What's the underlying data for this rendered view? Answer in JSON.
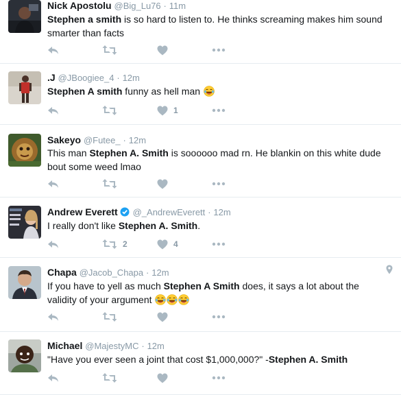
{
  "tweets": [
    {
      "name": "Nick Apostolu",
      "handle": "@Big_Lu76",
      "time": "11m",
      "line1": [
        {
          "t": "Stephen a smith",
          "b": true
        },
        {
          "t": " is so hard to listen to. He thinks screaming makes him sound"
        }
      ],
      "line2": [
        {
          "t": "smarter than facts"
        }
      ],
      "retweets": "",
      "likes": ""
    },
    {
      "name": ".J",
      "handle": "@JBoogiee_4",
      "time": "12m",
      "line1": [
        {
          "t": "Stephen A smith",
          "b": true
        },
        {
          "t": " funny as hell man"
        }
      ],
      "emoji_count": 1,
      "retweets": "",
      "likes": "1"
    },
    {
      "name": "Sakeyo",
      "handle": "@Futee_",
      "time": "12m",
      "line1": [
        {
          "t": "This man "
        },
        {
          "t": "Stephen A. Smith",
          "b": true
        },
        {
          "t": " is soooooo mad rn. He blankin on this white dude"
        }
      ],
      "line2": [
        {
          "t": "bout some weed lmao"
        }
      ],
      "retweets": "",
      "likes": ""
    },
    {
      "name": "Andrew Everett",
      "handle": "@_AndrewEverett",
      "time": "12m",
      "verified": true,
      "line1": [
        {
          "t": "I really don't like "
        },
        {
          "t": "Stephen A. Smith",
          "b": true
        },
        {
          "t": "."
        }
      ],
      "retweets": "2",
      "likes": "4"
    },
    {
      "name": "Chapa",
      "handle": "@Jacob_Chapa",
      "time": "12m",
      "has_location": true,
      "line1": [
        {
          "t": "If you have to yell as much "
        },
        {
          "t": "Stephen A Smith",
          "b": true
        },
        {
          "t": " does, it says a lot about the"
        }
      ],
      "line2": [
        {
          "t": "validity of your argument"
        }
      ],
      "emoji_count": 3,
      "retweets": "",
      "likes": ""
    },
    {
      "name": "Michael",
      "handle": "@MajestyMC",
      "time": "12m",
      "line1": [
        {
          "t": "\"Have you ever seen a joint that cost $1,000,000?\" -"
        },
        {
          "t": "Stephen A. Smith",
          "b": true
        }
      ],
      "retweets": "",
      "likes": ""
    }
  ],
  "separator": "·",
  "colors": {
    "icon": "#aab8c2",
    "muted": "#8899a6",
    "text": "#14171a",
    "verified": "#1da1f2",
    "divider": "#e6ecf0"
  },
  "icons": {
    "reply": "reply-icon",
    "retweet": "retweet-icon",
    "like": "heart-icon",
    "more": "more-icon",
    "verified": "verified-badge-icon",
    "location": "location-pin-icon",
    "emoji": "face-with-tears-of-joy-emoji"
  }
}
